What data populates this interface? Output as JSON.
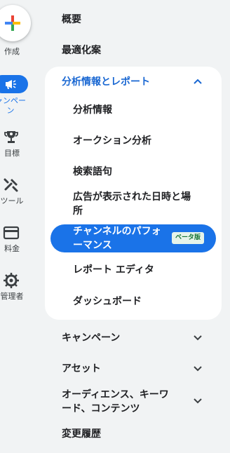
{
  "rail": {
    "create_label": "作成",
    "campaign_label": "ャンペーン",
    "goals_label": "目標",
    "tools_label": "ツール",
    "billing_label": "料金",
    "admin_label": "管理者"
  },
  "nav": {
    "overview": "概要",
    "recommendations": "最適化案",
    "insights_section": {
      "label": "分析情報とレポート",
      "items": [
        "分析情報",
        "オークション分析",
        "検索語句",
        "広告が表示された日時と場所",
        "レポート エディタ",
        "ダッシュボード"
      ],
      "active_item": "チャンネルのパフォーマンス",
      "active_badge": "ベータ版"
    },
    "campaigns": "キャンペーン",
    "assets": "アセット",
    "audiences": "オーディエンス、キーワード、コンテンツ",
    "change_history": "変更履歴"
  },
  "colors": {
    "accent": "#1a73e8",
    "section_text": "#1967d2",
    "badge_bg": "#e6f4ea",
    "badge_text": "#137333"
  }
}
